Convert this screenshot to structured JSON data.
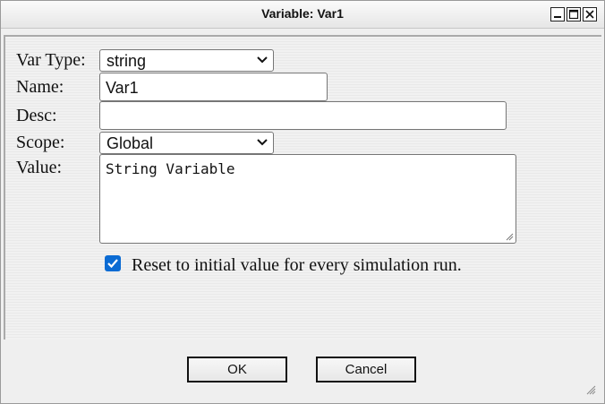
{
  "window": {
    "title": "Variable: Var1",
    "controls": [
      "minimize-icon",
      "maximize-icon",
      "close-icon"
    ]
  },
  "form": {
    "var_type": {
      "label": "Var Type:",
      "value": "string"
    },
    "name": {
      "label": "Name:",
      "value": "Var1"
    },
    "desc": {
      "label": "Desc:",
      "value": ""
    },
    "scope": {
      "label": "Scope:",
      "value": "Global"
    },
    "value": {
      "label": "Value:",
      "value": "String Variable"
    },
    "reset_checkbox": {
      "label": "Reset to initial value for every simulation run.",
      "checked": true
    }
  },
  "buttons": {
    "ok": "OK",
    "cancel": "Cancel"
  },
  "colors": {
    "accent": "#0b6bd3",
    "dialog_bg": "#efefef"
  }
}
